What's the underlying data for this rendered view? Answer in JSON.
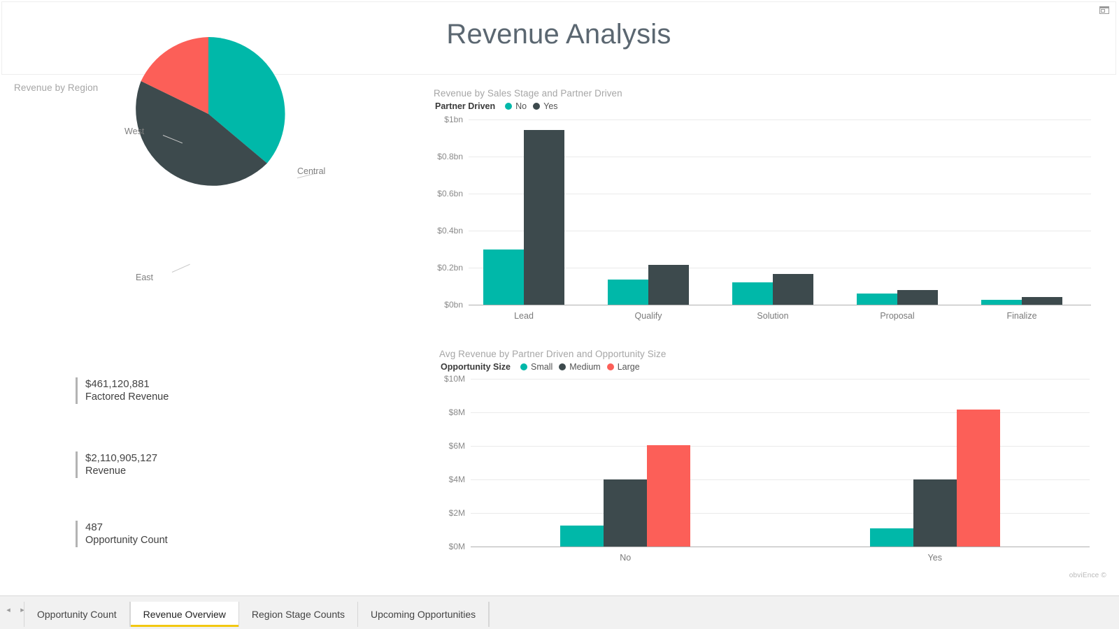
{
  "header": {
    "title": "Revenue Analysis",
    "corner_icon": "restore-window-icon"
  },
  "colors": {
    "teal": "#00B8A9",
    "dark_slate": "#3D4A4D",
    "coral": "#FC5F58",
    "title_text": "#5b6771",
    "visual_title": "#a6a6a6",
    "accent_tab": "#f2c811"
  },
  "pie_visual": {
    "title": "Revenue by Region"
  },
  "kpis": [
    {
      "value": "$461,120,881",
      "label": "Factored Revenue"
    },
    {
      "value": "$2,110,905,127",
      "label": "Revenue"
    },
    {
      "value": "487",
      "label": "Opportunity Count"
    }
  ],
  "watermark": "obviEnce ©",
  "tabbar": {
    "prev_arrow": "◂",
    "next_arrow": "▸",
    "tabs": [
      {
        "label": "Opportunity Count",
        "active": false
      },
      {
        "label": "Revenue Overview",
        "active": true
      },
      {
        "label": "Region Stage Counts",
        "active": false
      },
      {
        "label": "Upcoming Opportunities",
        "active": false
      }
    ]
  },
  "chart_data": [
    {
      "id": "revenue-by-region-pie",
      "type": "pie",
      "title": "Revenue by Region",
      "categories": [
        "Central",
        "East",
        "West"
      ],
      "values": [
        38,
        41,
        21
      ],
      "value_unit": "percent",
      "colors": [
        "#00B8A9",
        "#3D4A4D",
        "#FC5F58"
      ],
      "labels_shown": [
        "West",
        "Central",
        "East"
      ],
      "legend": "none",
      "start_angle_deg": 0
    },
    {
      "id": "revenue-by-sales-stage",
      "type": "bar",
      "title": "Revenue by Sales Stage and Partner Driven",
      "legend_title": "Partner Driven",
      "categories": [
        "Lead",
        "Qualify",
        "Solution",
        "Proposal",
        "Finalize"
      ],
      "series": [
        {
          "name": "No",
          "color": "#00B8A9",
          "values": [
            0.3,
            0.135,
            0.12,
            0.06,
            0.025
          ]
        },
        {
          "name": "Yes",
          "color": "#3D4A4D",
          "values": [
            0.945,
            0.215,
            0.165,
            0.08,
            0.04
          ]
        }
      ],
      "xlabel": "",
      "ylabel": "",
      "ylim": [
        0,
        1
      ],
      "ytick_values": [
        0,
        0.2,
        0.4,
        0.6,
        0.8,
        1
      ],
      "ytick_labels": [
        "$0bn",
        "$0.2bn",
        "$0.4bn",
        "$0.6bn",
        "$0.8bn",
        "$1bn"
      ],
      "grid": true,
      "legend_position": "top-left",
      "units": "billions USD"
    },
    {
      "id": "avg-revenue-by-partner-driven",
      "type": "bar",
      "title": "Avg Revenue by Partner Driven and Opportunity Size",
      "legend_title": "Opportunity Size",
      "categories": [
        "No",
        "Yes"
      ],
      "series": [
        {
          "name": "Small",
          "color": "#00B8A9",
          "values": [
            1.25,
            1.1
          ]
        },
        {
          "name": "Medium",
          "color": "#3D4A4D",
          "values": [
            4.0,
            4.0
          ]
        },
        {
          "name": "Large",
          "color": "#FC5F58",
          "values": [
            6.05,
            8.15
          ]
        }
      ],
      "xlabel": "",
      "ylabel": "",
      "ylim": [
        0,
        10
      ],
      "ytick_values": [
        0,
        2,
        4,
        6,
        8,
        10
      ],
      "ytick_labels": [
        "$0M",
        "$2M",
        "$4M",
        "$6M",
        "$8M",
        "$10M"
      ],
      "grid": true,
      "legend_position": "top-left",
      "units": "millions USD"
    }
  ]
}
